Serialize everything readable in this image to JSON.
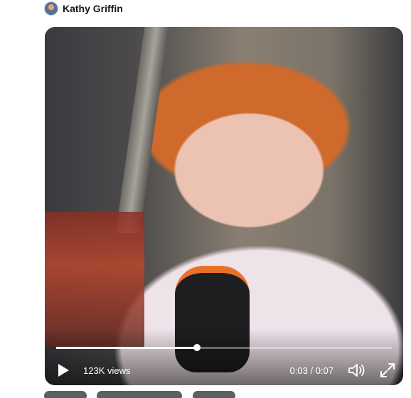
{
  "tweet": {
    "author_name": "Kathy Griffin"
  },
  "video": {
    "views_label": "123K views",
    "time_current": "0:03",
    "time_separator": "/",
    "time_total": "0:07",
    "progress_fraction": 0.42,
    "icons": {
      "play": "play-icon",
      "volume": "volume-icon",
      "fullscreen": "fullscreen-icon"
    }
  },
  "colors": {
    "author_text": "#14171a",
    "controls_text": "#ffffff"
  }
}
